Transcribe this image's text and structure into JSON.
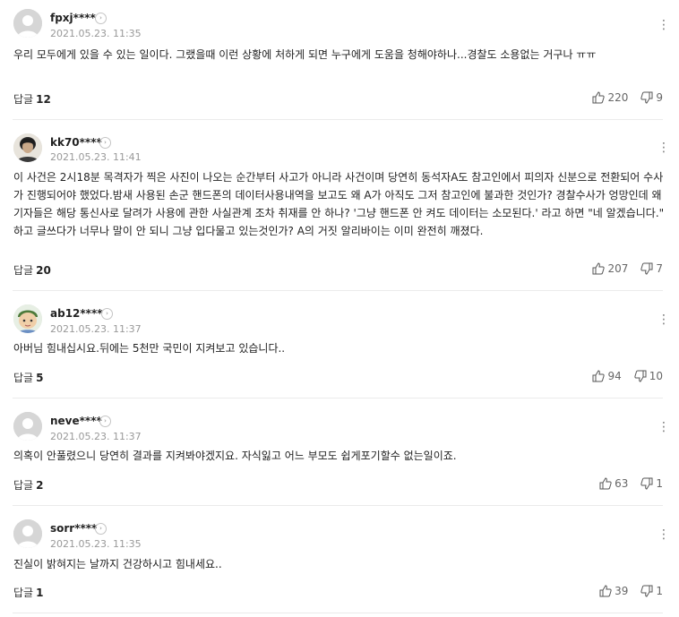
{
  "ui": {
    "reply_label": "답글",
    "more_glyph": "⋮",
    "chevron_glyph": "›"
  },
  "comments": [
    {
      "nick": "fpxj****",
      "date": "2021.05.23. 11:35",
      "body": "우리 모두에게 있을 수 있는 일이다. 그랬을때 이런 상황에 처하게 되면 누구에게 도움을 청해야하나...경찰도 소용없는 거구나 ㅠㅠ",
      "replies": "12",
      "likes": "220",
      "dislikes": "9",
      "avatar": "default-avatar"
    },
    {
      "nick": "kk70****",
      "date": "2021.05.23. 11:41",
      "body": "이 사건은 2시18분 목격자가 찍은 사진이 나오는 순간부터 사고가 아니라 사건이며 당연히 동석자A도 참고인에서 피의자 신분으로 전환되어 수사가 진행되어야 했었다.밤새 사용된 손군 핸드폰의 데이터사용내역을 보고도 왜 A가 아직도 그저 참고인에 불과한 것인가? 경찰수사가 엉망인데 왜 기자들은 해당 통신사로 달려가 사용에 관한 사실관계 조차 취재를 안 하나? '그냥 핸드폰 안 켜도 데이터는 소모된다.' 라고 하면 \"네 알겠습니다.\" 하고 글쓰다가 너무나 말이 안 되니 그냥 입다물고 있는것인가? A의 거짓 알리바이는 이미 완전히 깨졌다.",
      "replies": "20",
      "likes": "207",
      "dislikes": "7",
      "avatar": "photo-avatar"
    },
    {
      "nick": "ab12****",
      "date": "2021.05.23. 11:37",
      "body": "아버님 힘내십시요.뒤에는 5천만 국민이 지켜보고 있습니다..",
      "replies": "5",
      "likes": "94",
      "dislikes": "10",
      "avatar": "character-avatar"
    },
    {
      "nick": "neve****",
      "date": "2021.05.23. 11:37",
      "body": "의혹이 안풀렸으니 당연히 결과를 지켜봐야겠지요. 자식잃고 어느 부모도 쉽게포기할수 없는일이죠.",
      "replies": "2",
      "likes": "63",
      "dislikes": "1",
      "avatar": "default-avatar"
    },
    {
      "nick": "sorr****",
      "date": "2021.05.23. 11:35",
      "body": "진실이 밝혀지는 날까지 건강하시고 힘내세요..",
      "replies": "1",
      "likes": "39",
      "dislikes": "1",
      "avatar": "default-avatar"
    }
  ]
}
